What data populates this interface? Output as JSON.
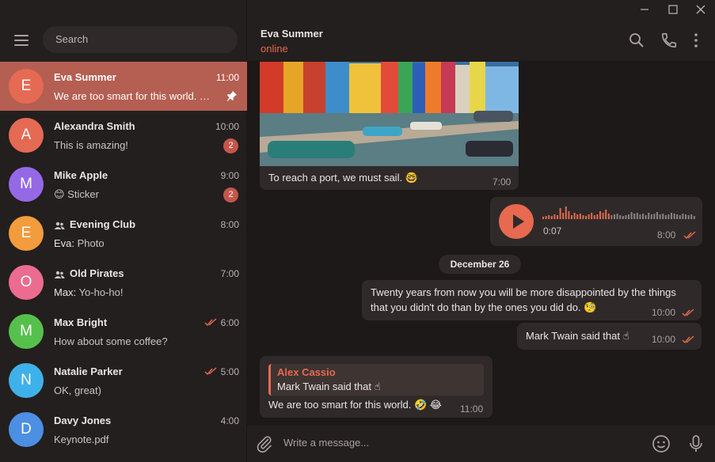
{
  "search": {
    "placeholder": "Search"
  },
  "chats": [
    {
      "initial": "E",
      "name": "Eva Summer",
      "time": "11:00",
      "message": "We are too smart for this world. 🤣 😂",
      "color": "#e56a54",
      "active": true,
      "pinned": true
    },
    {
      "initial": "A",
      "name": "Alexandra Smith",
      "time": "10:00",
      "message": "This is amazing!",
      "color": "#e56a54",
      "badge": "2"
    },
    {
      "initial": "M",
      "name": "Mike Apple",
      "time": "9:00",
      "message": "😊 Sticker",
      "color": "#9569e6",
      "badge": "2"
    },
    {
      "initial": "E",
      "name": "Evening Club",
      "time": "8:00",
      "sender": "Eva:",
      "message": "Photo",
      "color": "#f39c3d",
      "group": true
    },
    {
      "initial": "O",
      "name": "Old Pirates",
      "time": "7:00",
      "sender": "Max:",
      "message": "Yo-ho-ho!",
      "color": "#ec6c8f",
      "group": true
    },
    {
      "initial": "M",
      "name": "Max Bright",
      "time": "6:00",
      "message": "How about some coffee?",
      "color": "#55c14c",
      "read": true
    },
    {
      "initial": "N",
      "name": "Natalie Parker",
      "time": "5:00",
      "message": "OK, great)",
      "color": "#3fb1ea",
      "read": true
    },
    {
      "initial": "D",
      "name": "Davy Jones",
      "time": "4:00",
      "message": "Keynote.pdf",
      "color": "#4d8fe3"
    }
  ],
  "header": {
    "name": "Eva Summer",
    "status": "online"
  },
  "messages": {
    "photo_caption": "To reach a port, we must sail. 🤓",
    "photo_time": "7:00",
    "voice_duration": "0:07",
    "voice_time": "8:00",
    "date_separator": "December 26",
    "quote_line1": "Twenty years from now you will be more disappointed by the things",
    "quote_line2": "that you didn't do than by the ones you did do. 🧐",
    "quote_time": "10:00",
    "twain_text": "Mark Twain said that ☝",
    "twain_time": "10:00",
    "reply_author": "Alex Cassio",
    "reply_quote": "Mark Twain said that ☝",
    "reply_text": "We are too smart for this world. 🤣 😂",
    "reply_time": "11:00"
  },
  "composer": {
    "placeholder": "Write a message..."
  },
  "colors": {
    "accent": "#e7694f",
    "active_chat": "#b55e52",
    "bubble": "#2f2a29",
    "background": "#1c1918"
  },
  "icons": [
    "menu-icon",
    "search-icon",
    "phone-icon",
    "more-icon",
    "attach-icon",
    "emoji-icon",
    "microphone-icon",
    "pin-icon",
    "group-icon",
    "double-check-icon",
    "play-icon",
    "minimize-icon",
    "maximize-icon",
    "close-icon"
  ]
}
